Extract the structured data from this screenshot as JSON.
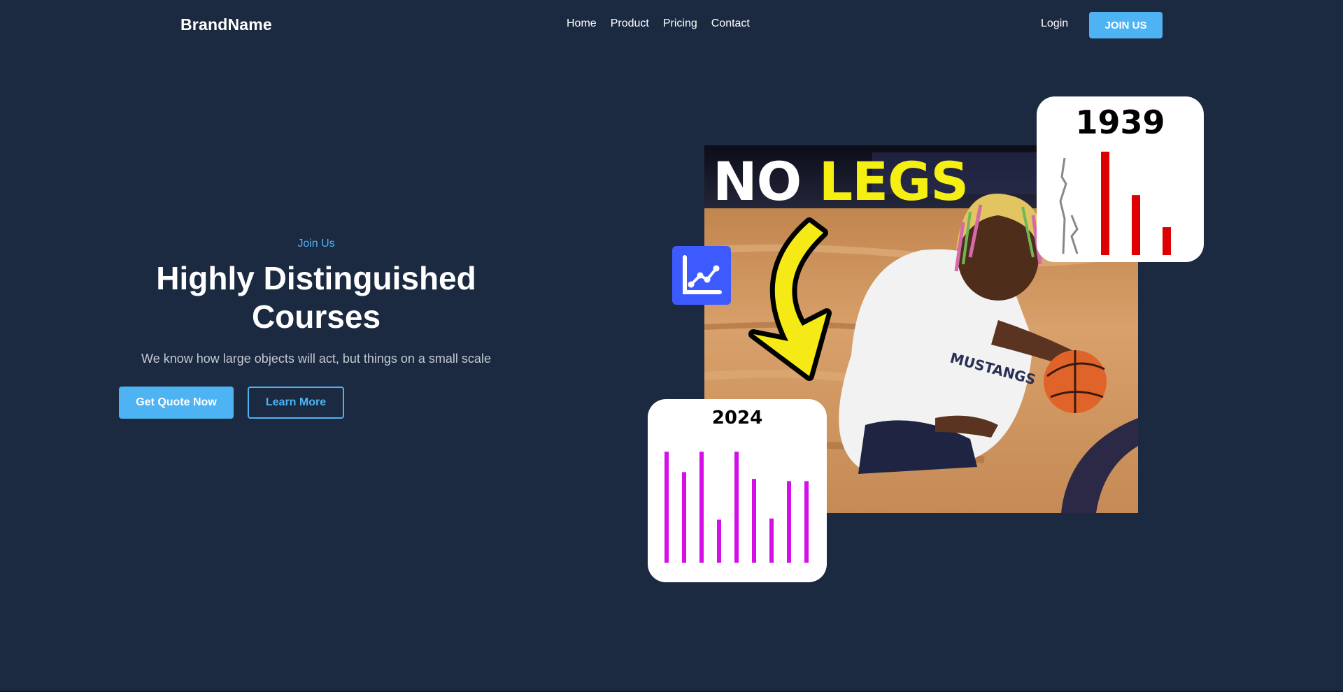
{
  "nav": {
    "brand": "BrandName",
    "items": [
      {
        "label": "Home"
      },
      {
        "label": "Product"
      },
      {
        "label": "Pricing"
      },
      {
        "label": "Contact"
      }
    ],
    "login_label": "Login",
    "cta_label": "JOIN US"
  },
  "hero": {
    "eyebrow": "Join Us",
    "title_line1": "Highly Distinguished",
    "title_line2": "Courses",
    "subtitle": "We know how large objects will act, but things on a small scale",
    "primary_button": "Get Quote Now",
    "secondary_button": "Learn More"
  },
  "image": {
    "caption_word1": "NO",
    "caption_word2": "LEGS",
    "jersey_text": "MUSTANGS"
  },
  "cards": {
    "card_1939": {
      "year": "1939",
      "bar_color": "#dd0000",
      "bars": [
        1.0,
        0.58,
        0.27
      ]
    },
    "card_2024": {
      "year": "2024",
      "bar_color": "#d40fe8",
      "bars": [
        0.98,
        0.8,
        0.98,
        0.38,
        0.98,
        0.74,
        0.39,
        0.72,
        0.72
      ]
    }
  },
  "badge": {
    "icon": "line-chart-icon"
  },
  "colors": {
    "background": "#1b2a41",
    "accent": "#4eb3f3",
    "badge": "#3d5afe"
  }
}
